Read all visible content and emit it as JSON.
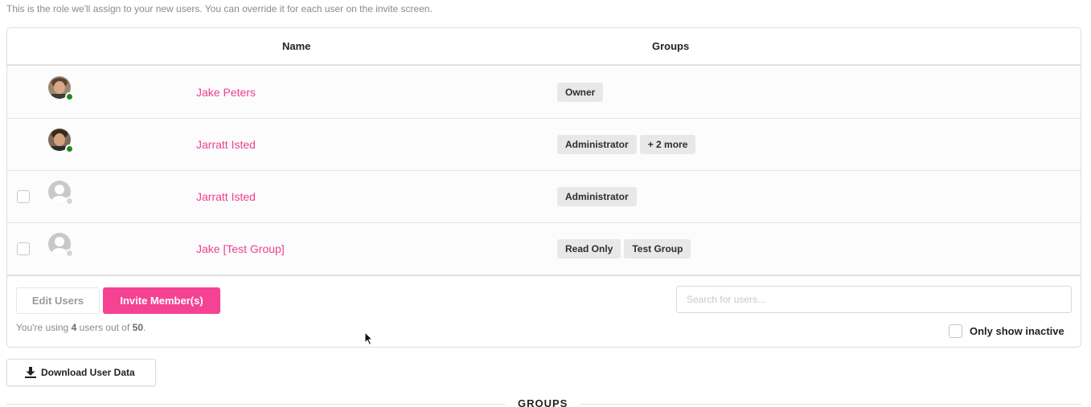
{
  "hint_text": "This is the role we'll assign to your new users. You can override it for each user on the invite screen.",
  "table": {
    "headers": {
      "name": "Name",
      "groups": "Groups"
    },
    "rows": [
      {
        "name": "Jake Peters",
        "groups": [
          "Owner"
        ],
        "online": true,
        "has_photo": true,
        "selectable": false
      },
      {
        "name": "Jarratt Isted",
        "groups": [
          "Administrator",
          "+ 2 more"
        ],
        "online": true,
        "has_photo": true,
        "selectable": false
      },
      {
        "name": "Jarratt Isted",
        "groups": [
          "Administrator"
        ],
        "online": false,
        "has_photo": false,
        "selectable": true
      },
      {
        "name": "Jake [Test Group]",
        "groups": [
          "Read Only",
          "Test Group"
        ],
        "online": false,
        "has_photo": false,
        "selectable": true
      }
    ]
  },
  "footer": {
    "edit_label": "Edit Users",
    "invite_label": "Invite Member(s)",
    "usage_prefix": "You're using ",
    "usage_count": "4",
    "usage_middle": " users out of ",
    "usage_limit": "50",
    "usage_suffix": ".",
    "search_placeholder": "Search for users...",
    "inactive_label": "Only show inactive"
  },
  "download_label": "Download User Data",
  "section_title": "GROUPS",
  "colors": {
    "accent": "#f54293",
    "link": "#ee3f8f",
    "online": "#1e8a1e",
    "offline": "#d6d6d6"
  }
}
